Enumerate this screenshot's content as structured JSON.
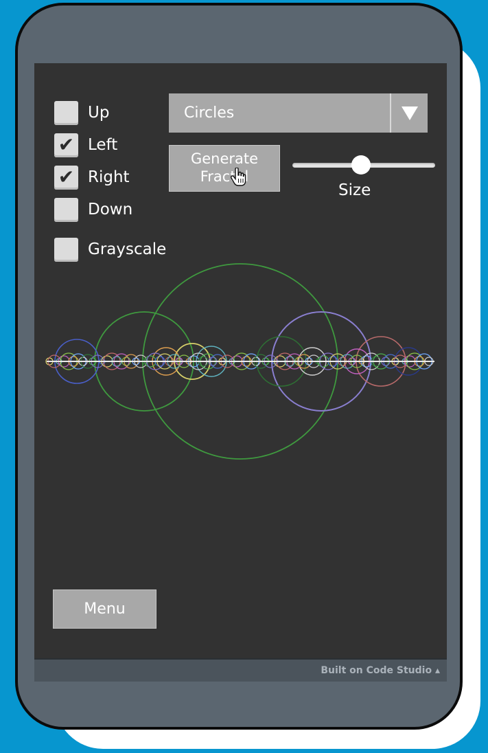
{
  "controls": {
    "checkboxes": [
      {
        "label": "Up",
        "checked": false
      },
      {
        "label": "Left",
        "checked": true
      },
      {
        "label": "Right",
        "checked": true
      },
      {
        "label": "Down",
        "checked": false
      }
    ],
    "grayscale": {
      "label": "Grayscale",
      "checked": false
    },
    "shape_dropdown": {
      "value": "Circles"
    },
    "generate_button": {
      "line1": "Generate",
      "line2": "Fractal"
    },
    "size_slider": {
      "label": "Size",
      "value_fraction": 0.48
    }
  },
  "menu_button": {
    "label": "Menu"
  },
  "footer": {
    "text": "Built on Code Studio ▴"
  },
  "colors": {
    "background": "#0796cf",
    "phone_frame": "#5b6670",
    "screen": "#323232",
    "button": "#a8a8a8"
  },
  "icons": {
    "checkmark": "check-icon",
    "dropdown_arrow": "triangle-down-icon",
    "cursor": "hand-pointer-icon"
  }
}
